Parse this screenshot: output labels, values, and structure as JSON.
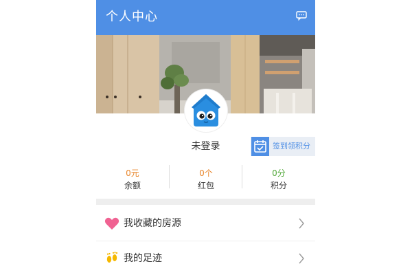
{
  "header": {
    "title": "个人中心",
    "message_icon": "chat-bubble-icon"
  },
  "banner": {
    "description_icon": "interior-photo"
  },
  "profile": {
    "avatar_icon": "house-mascot-icon",
    "username": "未登录",
    "checkin_icon": "calendar-check-icon",
    "checkin_label": "签到领积分"
  },
  "stats": [
    {
      "value": "0元",
      "label": "余额",
      "color": "#e8852a"
    },
    {
      "value": "0个",
      "label": "红包",
      "color": "#e8852a"
    },
    {
      "value": "0分",
      "label": "积分",
      "color": "#52a839"
    }
  ],
  "menu": [
    {
      "label": "我收藏的房源",
      "icon": "heart-icon",
      "color": "#f06292"
    },
    {
      "label": "我的足迹",
      "icon": "footprints-icon",
      "color": "#f5b800"
    }
  ],
  "colors": {
    "primary": "#4f8fe5",
    "orange": "#e8852a",
    "green": "#52a839"
  }
}
